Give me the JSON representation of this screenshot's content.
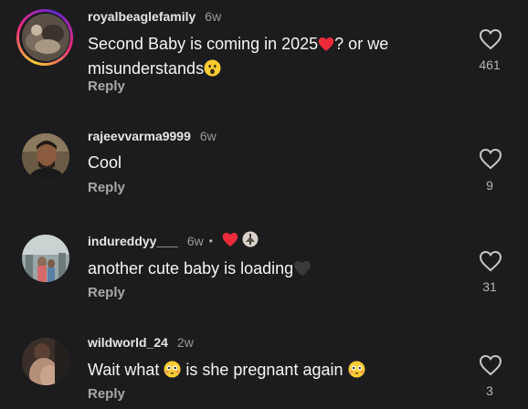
{
  "comments": [
    {
      "username": "royalbeaglefamily",
      "time": "6w",
      "text_before": "Second Baby is coming in 2025",
      "text_mid": "? or we misunderstands",
      "text_after": "",
      "reply_label": "Reply",
      "likes": "461"
    },
    {
      "username": "rajeevvarma9999",
      "time": "6w",
      "text_before": "Cool",
      "reply_label": "Reply",
      "likes": "9"
    },
    {
      "username": "indureddyy___",
      "time": "6w",
      "separator": "•",
      "text_before": "another cute baby is loading",
      "reply_label": "Reply",
      "likes": "31"
    },
    {
      "username": "wildworld_24",
      "time": "2w",
      "text_before": "Wait what ",
      "text_mid": " is she pregnant again ",
      "reply_label": "Reply",
      "likes": "3"
    }
  ],
  "colors": {
    "background": "#1c1c1e",
    "heart_red": "#ee2b3a",
    "black_heart": "#3a3a3a",
    "emoji_yellow": "#ffcc33",
    "story_ring": "#ee2a7b"
  },
  "icons": {
    "like": "heart-outline-icon",
    "red_heart": "red-heart-emoji",
    "black_heart": "black-heart-emoji",
    "surprised": "surprised-face-emoji",
    "flushed": "flushed-face-emoji"
  }
}
